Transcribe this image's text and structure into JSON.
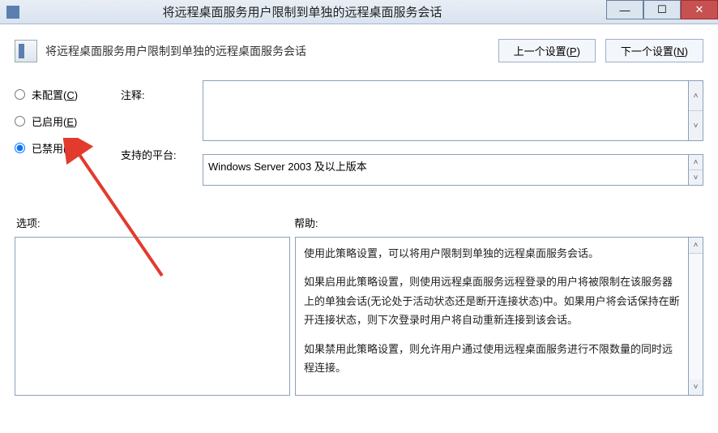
{
  "window": {
    "title": "将远程桌面服务用户限制到单独的远程桌面服务会话"
  },
  "header": {
    "policy_name": "将远程桌面服务用户限制到单独的远程桌面服务会话",
    "prev_label": "上一个设置(",
    "prev_key": "P",
    "prev_tail": ")",
    "next_label": "下一个设置(",
    "next_key": "N",
    "next_tail": ")"
  },
  "state": {
    "not_configured": "未配置(",
    "not_configured_key": "C",
    "enabled": "已启用(",
    "enabled_key": "E",
    "disabled": "已禁用(",
    "disabled_key": "D",
    "close_paren": ")",
    "selected": "disabled"
  },
  "labels": {
    "comment": "注释:",
    "supported": "支持的平台:",
    "options": "选项:",
    "help": "帮助:"
  },
  "fields": {
    "comment_value": "",
    "supported_value": "Windows Server 2003 及以上版本"
  },
  "help": {
    "p1": "使用此策略设置，可以将用户限制到单独的远程桌面服务会话。",
    "p2": "如果启用此策略设置，则使用远程桌面服务远程登录的用户将被限制在该服务器上的单独会话(无论处于活动状态还是断开连接状态)中。如果用户将会话保持在断开连接状态，则下次登录时用户将自动重新连接到该会话。",
    "p3": "如果禁用此策略设置，则允许用户通过使用远程桌面服务进行不限数量的同时远程连接。"
  },
  "glyphs": {
    "up": "˄",
    "down": "˅",
    "minimize": "—",
    "maximize": "☐",
    "close": "✕"
  }
}
